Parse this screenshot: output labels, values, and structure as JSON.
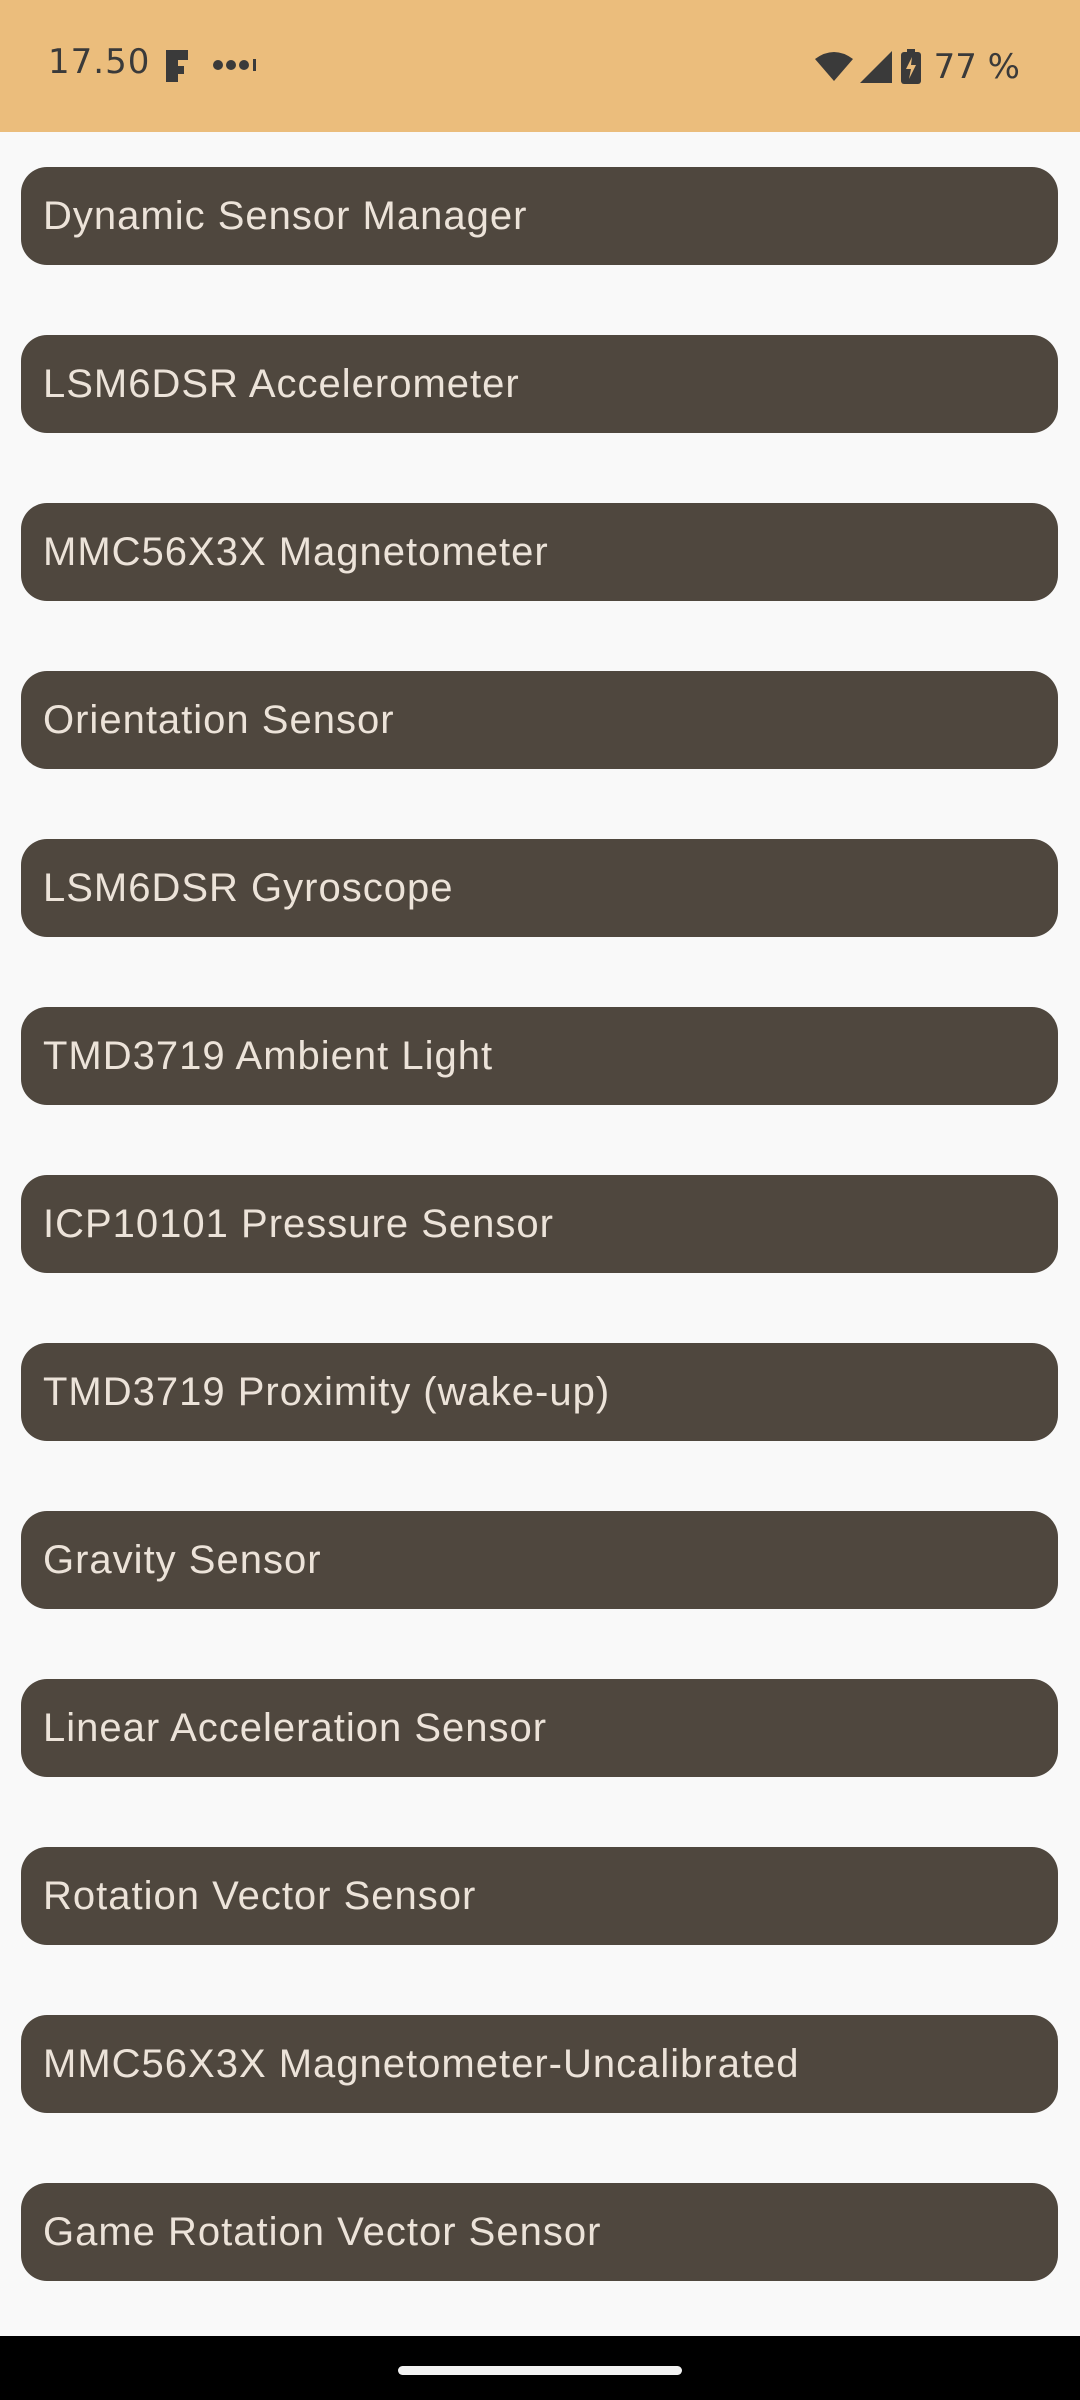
{
  "status_bar": {
    "time": "17.50",
    "battery": "77 %",
    "icons": [
      "app-notification-icon",
      "more-notifications-icon",
      "wifi-icon",
      "cell-signal-icon",
      "battery-charging-icon"
    ]
  },
  "sensors": [
    {
      "label": "Dynamic Sensor Manager"
    },
    {
      "label": "LSM6DSR Accelerometer"
    },
    {
      "label": "MMC56X3X Magnetometer"
    },
    {
      "label": "Orientation Sensor"
    },
    {
      "label": "LSM6DSR Gyroscope"
    },
    {
      "label": "TMD3719 Ambient Light"
    },
    {
      "label": "ICP10101 Pressure Sensor"
    },
    {
      "label": "TMD3719 Proximity (wake-up)"
    },
    {
      "label": "Gravity Sensor"
    },
    {
      "label": "Linear Acceleration Sensor"
    },
    {
      "label": "Rotation Vector Sensor"
    },
    {
      "label": "MMC56X3X Magnetometer-Uncalibrated"
    },
    {
      "label": "Game Rotation Vector Sensor"
    }
  ],
  "colors": {
    "status_bar_bg": "#ebbd7c",
    "button_bg": "#4f473e",
    "button_text": "#ece3d9",
    "page_bg": "#f9f9f9"
  }
}
